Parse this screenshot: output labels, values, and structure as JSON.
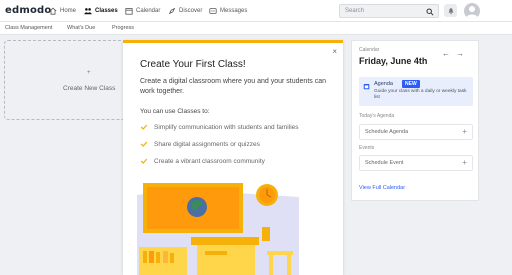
{
  "app": {
    "logo": "edmodo"
  },
  "nav": {
    "items": [
      {
        "label": "Home",
        "icon": "home-icon"
      },
      {
        "label": "Classes",
        "icon": "classes-icon",
        "active": true
      },
      {
        "label": "Calendar",
        "icon": "calendar-icon"
      },
      {
        "label": "Discover",
        "icon": "discover-icon"
      },
      {
        "label": "Messages",
        "icon": "messages-icon"
      }
    ],
    "search_placeholder": "Search"
  },
  "subnav": {
    "items": [
      "Class Management",
      "What's Due",
      "Progress"
    ]
  },
  "create_box": {
    "plus": "+",
    "label": "Create New Class"
  },
  "modal": {
    "close": "×",
    "title": "Create Your First Class!",
    "description": "Create a digital classroom where you and your students can work together.",
    "subheading": "You can use Classes to:",
    "items": [
      "Simplify communication with students and families",
      "Share digital assignments or quizzes",
      "Create a vibrant classroom community"
    ]
  },
  "calendar": {
    "label": "Calendar",
    "date": "Friday, June 4th",
    "prev": "←",
    "next": "→",
    "agenda_title": "Agenda",
    "agenda_badge": "NEW",
    "agenda_desc": "Guide your class with a daily or weekly task list",
    "todays_agenda_label": "Today's Agenda",
    "schedule_agenda": "Schedule Agenda",
    "events_label": "Events",
    "schedule_event": "Schedule Event",
    "plus": "+",
    "view_full": "View Full Calendar"
  },
  "colors": {
    "accent": "#f5b10a",
    "link": "#2d5cf6",
    "check": "#f5b10a"
  }
}
